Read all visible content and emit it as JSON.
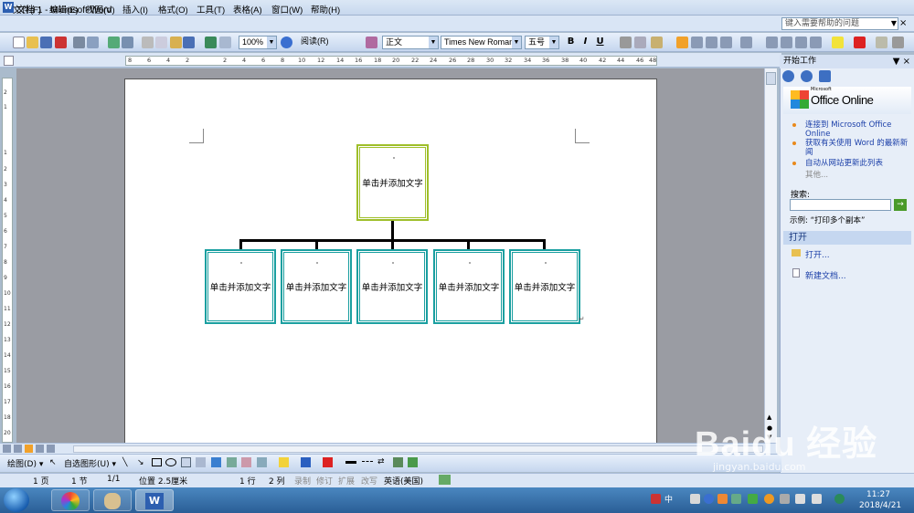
{
  "window": {
    "title": "文档 1 - Microsoft Word",
    "icon": "W"
  },
  "menu": {
    "items": [
      "文件(F)",
      "编辑(E)",
      "视图(V)",
      "插入(I)",
      "格式(O)",
      "工具(T)",
      "表格(A)",
      "窗口(W)",
      "帮助(H)"
    ],
    "help_placeholder": "键入需要帮助的问题",
    "help_arrow": "▼",
    "close": "×"
  },
  "toolbar": {
    "zoom": "100%",
    "read_label": "阅读(R)",
    "style": "正文",
    "font": "Times New Roman",
    "size": "五号",
    "bold": "B",
    "italic": "I",
    "underline": "U"
  },
  "ruler": {
    "h_ticks": [
      "8",
      "6",
      "4",
      "2",
      "",
      "2",
      "4",
      "6",
      "8",
      "10",
      "12",
      "14",
      "16",
      "18",
      "20",
      "22",
      "24",
      "26",
      "28",
      "30",
      "32",
      "34",
      "36",
      "38",
      "40",
      "42",
      "44",
      "46",
      "48"
    ],
    "v_ticks": [
      "2",
      "1",
      "",
      "1",
      "2",
      "3",
      "4",
      "5",
      "6",
      "7",
      "8",
      "9",
      "10",
      "11",
      "12",
      "13",
      "14",
      "15",
      "16",
      "17",
      "18",
      "19",
      "20"
    ]
  },
  "diagram": {
    "root_text": "单击并添加文字",
    "children": [
      "单击并添加文字",
      "单击并添加文字",
      "单击并添加文字",
      "单击并添加文字",
      "单击并添加文字"
    ],
    "root_color": "#9fbf2a",
    "child_color": "#1a9fa0"
  },
  "taskpane": {
    "title": "开始工作",
    "close": "▼ ×",
    "office_small": "Microsoft",
    "office_text": "Office Online",
    "links": [
      "连接到 Microsoft Office Online",
      "获取有关使用 Word 的最新新闻",
      "自动从网站更新此列表"
    ],
    "more": "其他...",
    "search_label": "搜索:",
    "search_go": "→",
    "example": "示例: “打印多个副本”",
    "open_head": "打开",
    "open_item": "打开...",
    "new_item": "新建文档..."
  },
  "drawbar": {
    "draw": "绘图(D) ▾",
    "autoshapes": "自选图形(U) ▾"
  },
  "status": {
    "page": "1 页",
    "section": "1 节",
    "pages": "1/1",
    "position": "位置 2.5厘米",
    "line": "1 行",
    "col": "2 列",
    "rec": "录制",
    "trk": "修订",
    "ext": "扩展",
    "ovr": "改写",
    "lang": "英语(美国)"
  },
  "taskbar": {
    "time": "11:27",
    "date": "2018/4/21",
    "ime": "中"
  },
  "watermark": {
    "text": "Baidu 经验",
    "url": "jingyan.baidu.com"
  }
}
